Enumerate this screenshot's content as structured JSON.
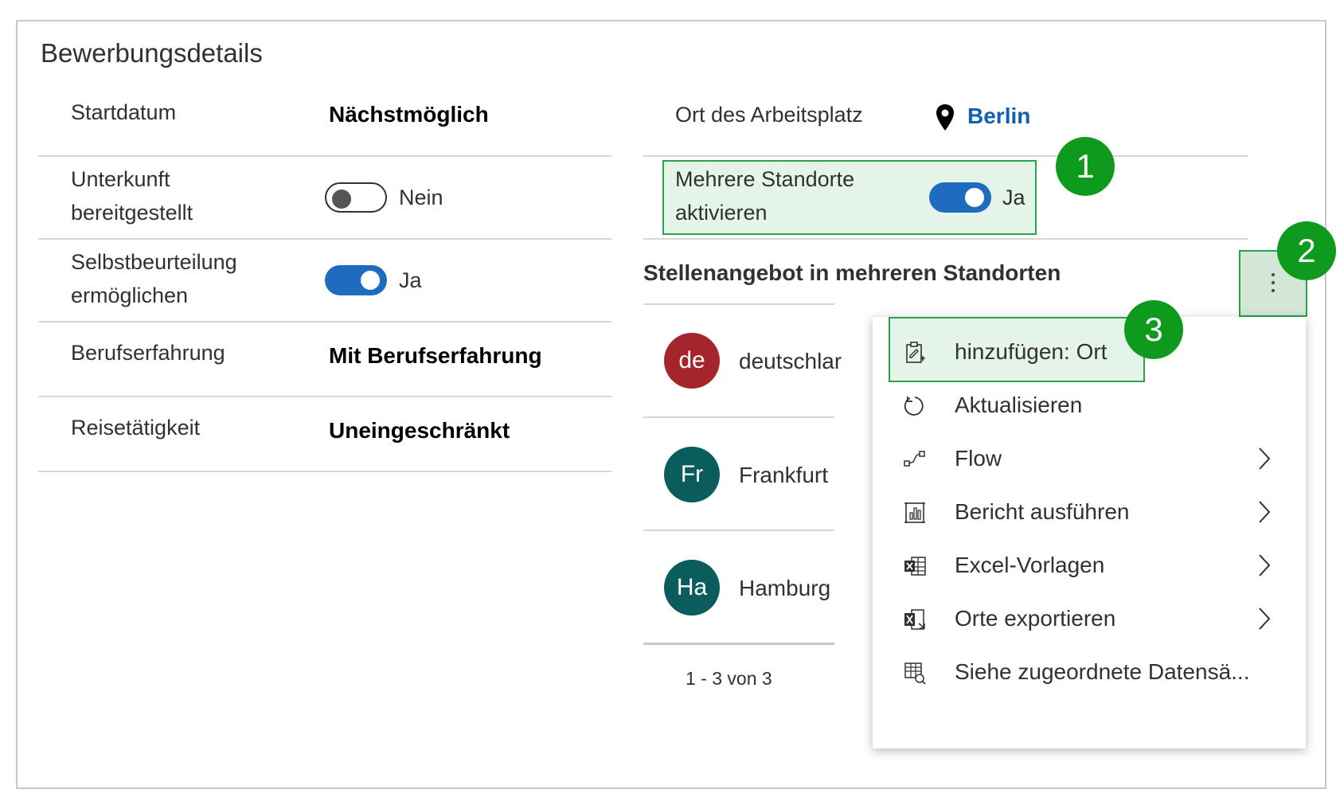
{
  "section": {
    "title": "Bewerbungsdetails"
  },
  "fields": {
    "startdatum": {
      "label": "Startdatum",
      "value": "Nächstmöglich"
    },
    "unterkunft": {
      "label_line1": "Unterkunft",
      "label_line2": "bereitgestellt",
      "toggle_label": "Nein",
      "toggle_on": false
    },
    "selbst": {
      "label_line1": "Selbstbeurteilung",
      "label_line2": "ermöglichen",
      "toggle_label": "Ja",
      "toggle_on": true
    },
    "berufserfahrung": {
      "label": "Berufserfahrung",
      "value": "Mit Berufserfahrung"
    },
    "reise": {
      "label": "Reisetätigkeit",
      "value": "Uneingeschränkt"
    },
    "ort": {
      "label": "Ort des Arbeitsplatz",
      "value": "Berlin"
    },
    "mehrere": {
      "label_line1": "Mehrere Standorte",
      "label_line2": "aktivieren",
      "toggle_label": "Ja",
      "toggle_on": true
    }
  },
  "subgrid": {
    "title": "Stellenangebot in mehreren Standorten",
    "rows": [
      {
        "initials": "de",
        "name": "deutschlar",
        "color": "#a4262c"
      },
      {
        "initials": "Fr",
        "name": "Frankfurt",
        "color": "#0b5c5c"
      },
      {
        "initials": "Ha",
        "name": "Hamburg",
        "color": "#0b5c5c"
      }
    ],
    "pagination": "1 - 3 von 3"
  },
  "menu": {
    "items": [
      {
        "label": "hinzufügen: Ort",
        "icon": "add-record-icon",
        "submenu": false
      },
      {
        "label": "Aktualisieren",
        "icon": "refresh-icon",
        "submenu": false
      },
      {
        "label": "Flow",
        "icon": "flow-icon",
        "submenu": true
      },
      {
        "label": "Bericht ausführen",
        "icon": "report-icon",
        "submenu": true
      },
      {
        "label": "Excel-Vorlagen",
        "icon": "excel-template-icon",
        "submenu": true
      },
      {
        "label": "Orte exportieren",
        "icon": "excel-export-icon",
        "submenu": true
      },
      {
        "label": "Siehe zugeordnete Datensä...",
        "icon": "associated-records-icon",
        "submenu": false
      }
    ]
  },
  "callouts": [
    "1",
    "2",
    "3"
  ],
  "colors": {
    "accent": "#1f6bbf",
    "link": "#0f5fb4",
    "callout": "#0e9a1c",
    "highlight": "#e4f4e8"
  }
}
